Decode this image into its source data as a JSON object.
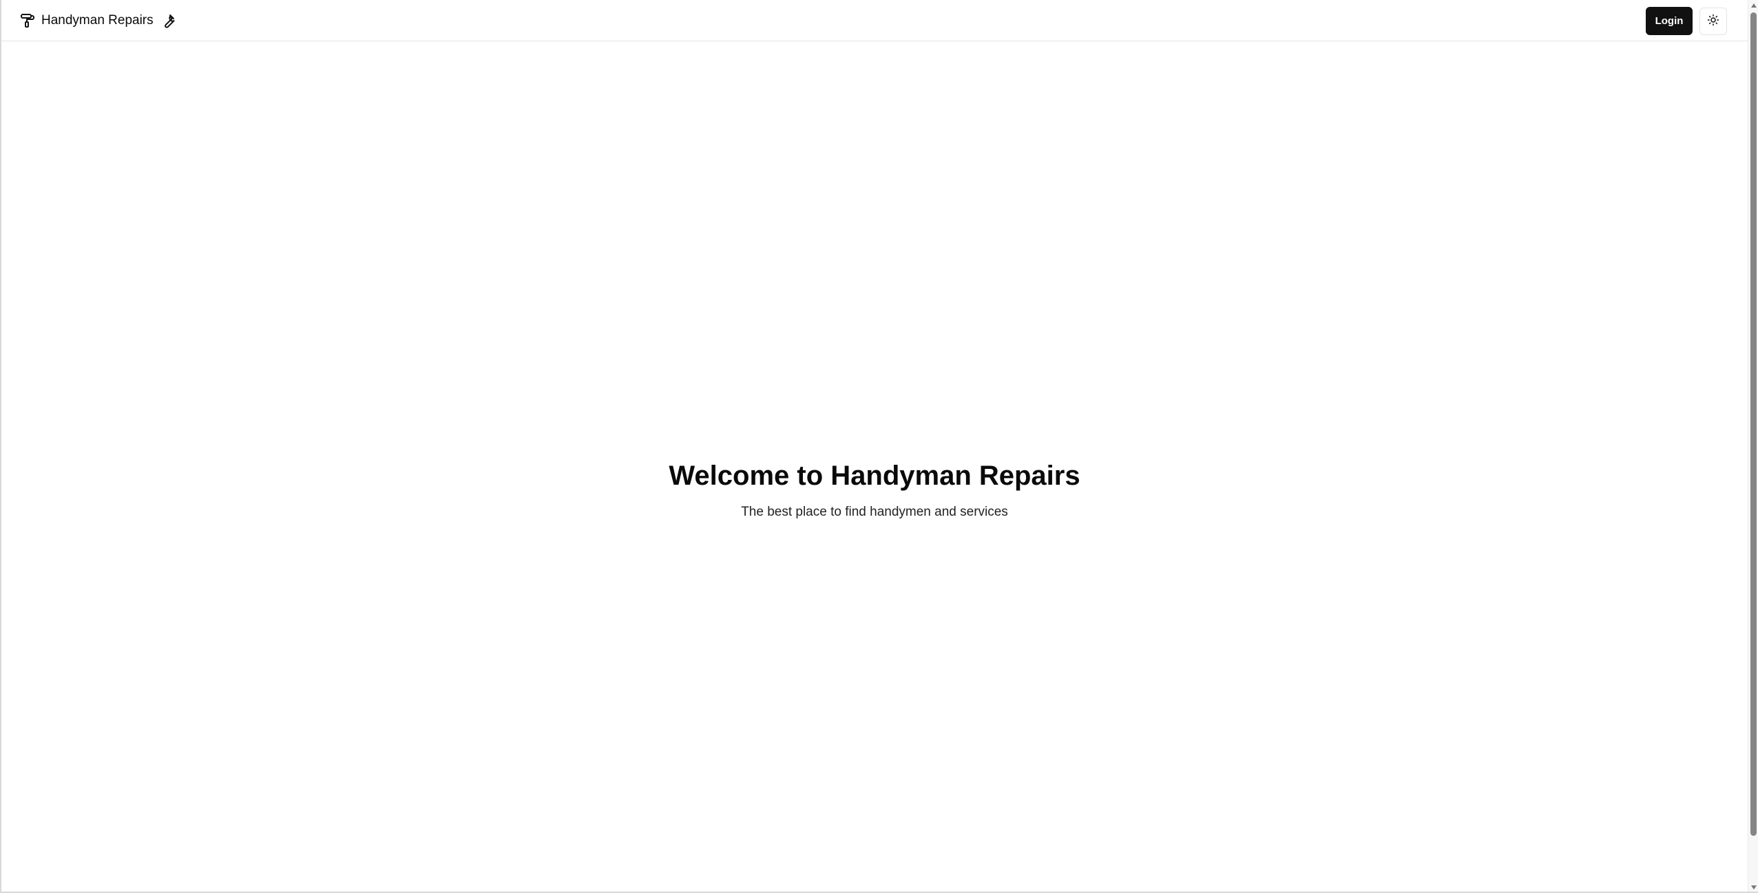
{
  "header": {
    "brand_label": "Handyman Repairs",
    "login_label": "Login",
    "icons": {
      "brand": "paint-roller-icon",
      "brand_suffix": "wrench-icon",
      "theme": "sun-icon"
    }
  },
  "hero": {
    "title": "Welcome to Handyman Repairs",
    "subtitle": "The best place to find handymen and services"
  },
  "colors": {
    "background": "#ffffff",
    "text": "#0a0a0a",
    "button": "#111111",
    "border": "#e4e4e7"
  }
}
